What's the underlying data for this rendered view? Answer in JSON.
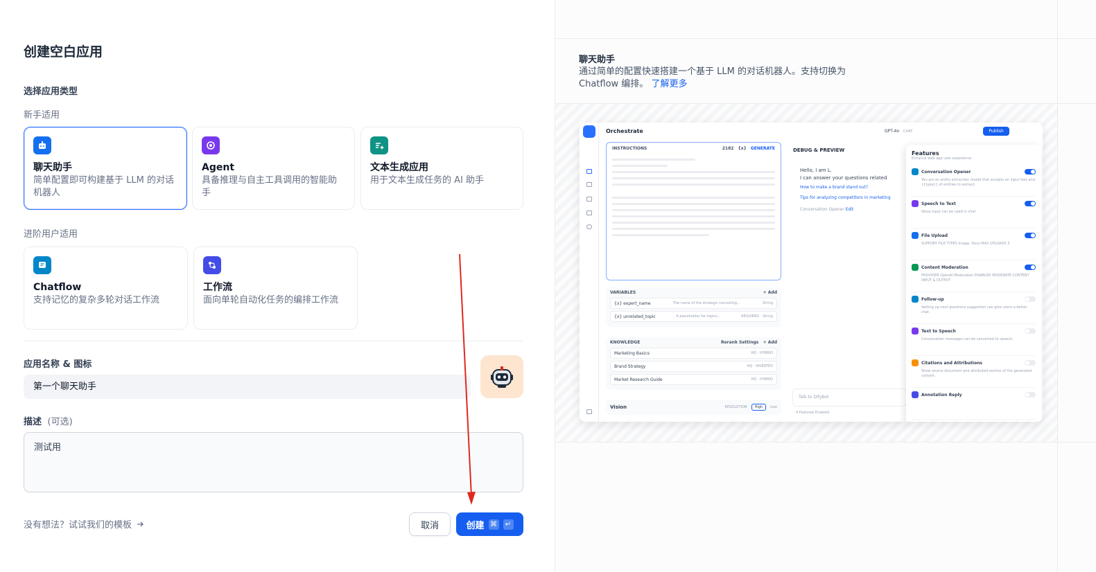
{
  "page_title": "创建空白应用",
  "app_type": {
    "section_title": "选择应用类型",
    "beginner_label": "新手适用",
    "advanced_label": "进阶用户适用",
    "cards": [
      {
        "title": "聊天助手",
        "desc": "简单配置即可构建基于 LLM 的对话机器人",
        "color": "#1570ef",
        "selected": true
      },
      {
        "title": "Agent",
        "desc": "具备推理与自主工具调用的智能助手",
        "color": "#7839ee",
        "selected": false
      },
      {
        "title": "文本生成应用",
        "desc": "用于文本生成任务的 AI 助手",
        "color": "#0e9384",
        "selected": false
      },
      {
        "title": "Chatflow",
        "desc": "支持记忆的复杂多轮对话工作流",
        "color": "#0086c9",
        "selected": false
      },
      {
        "title": "工作流",
        "desc": "面向单轮自动化任务的编排工作流",
        "color": "#444ce7",
        "selected": false
      }
    ]
  },
  "name_section": {
    "label": "应用名称 & 图标",
    "value": "第一个聊天助手",
    "avatar_bg": "#fde5cf"
  },
  "desc_section": {
    "label": "描述",
    "optional": "(可选)",
    "value": "测试用"
  },
  "footer": {
    "template_link": "没有想法？试试我们的模板",
    "cancel_label": "取消",
    "create_label": "创建",
    "shortcut_cmd": "⌘",
    "shortcut_enter": "↵"
  },
  "annotation": {
    "arrow_color": "#e0281f"
  },
  "preview_panel": {
    "title": "聊天助手",
    "desc": "通过简单的配置快速搭建一个基于 LLM 的对话机器人。支持切换为 Chatflow 编排。",
    "learn_more": "了解更多",
    "mock": {
      "header": "Orchestrate",
      "model": "GPT-4o",
      "model_tag": "CHAT",
      "publish": "Publish",
      "instructions": "INSTRUCTIONS",
      "instr_count": "2182",
      "instr_var": "{x}",
      "generate": "GENERATE",
      "variables": {
        "title": "VARIABLES",
        "add": "+ Add",
        "rows": [
          {
            "name": "{x} expert_name",
            "hint": "The name of the strategic consulting...",
            "tag": "String"
          },
          {
            "name": "{x} unrelated_topic",
            "hint": "A placeholder for topics...",
            "tag": "REQUIRED · String"
          }
        ]
      },
      "knowledge": {
        "title": "KNOWLEDGE",
        "rerank": "Rerank Settings",
        "add": "+ Add",
        "rows": [
          {
            "name": "Marketing Basics",
            "tag": "HQ · HYBRID"
          },
          {
            "name": "Brand Strategy",
            "tag": "HQ · INVERTED"
          },
          {
            "name": "Market Research Guide",
            "tag": "HQ · HYBRID"
          }
        ]
      },
      "vision": {
        "label": "Vision",
        "resolution": "RESOLUTION",
        "high": "High",
        "low": "Low"
      },
      "debug": {
        "title": "DEBUG & PREVIEW",
        "hello": "Hello, I am L.",
        "intro": "I can answer your questions related",
        "q1": "How to make a brand stand out?",
        "q2": "Tips for analyzing competitors in marketing",
        "opener": "Conversation Opener",
        "edit": "Edit",
        "input_placeholder": "Talk to DifyBot",
        "features_enabled": "4 Features Enabled"
      },
      "features": {
        "title": "Features",
        "subtitle": "Enhance web app user experience",
        "items": [
          {
            "name": "Conversation Opener",
            "desc": "You are an entity extraction model that accepts an input text and {{type}} of entities to extract.",
            "on": true,
            "color": "#0086c9"
          },
          {
            "name": "Speech to Text",
            "desc": "Voice input can be used in chat.",
            "on": true,
            "color": "#7839ee"
          },
          {
            "name": "File Upload",
            "desc": "SUPPORT FILE TYPES  Image, Docs     MAX UPLOADS  3",
            "on": true,
            "color": "#1570ef"
          },
          {
            "name": "Content Moderation",
            "desc": "PROVIDER  OpenAI Moderation     ENABLED MODERATE CONTENT  INPUT & OUTPUT",
            "on": true,
            "color": "#039855"
          },
          {
            "name": "Follow-up",
            "desc": "Setting up next questions suggestion can give users a better chat.",
            "on": false,
            "color": "#0086c9"
          },
          {
            "name": "Text to Speech",
            "desc": "Conversation messages can be converted to speech.",
            "on": false,
            "color": "#7839ee"
          },
          {
            "name": "Citations and Attributions",
            "desc": "Show source document and attributed section of the generated content.",
            "on": false,
            "color": "#f79009"
          },
          {
            "name": "Annotation Reply",
            "desc": "",
            "on": false,
            "color": "#444ce7"
          }
        ]
      }
    }
  }
}
